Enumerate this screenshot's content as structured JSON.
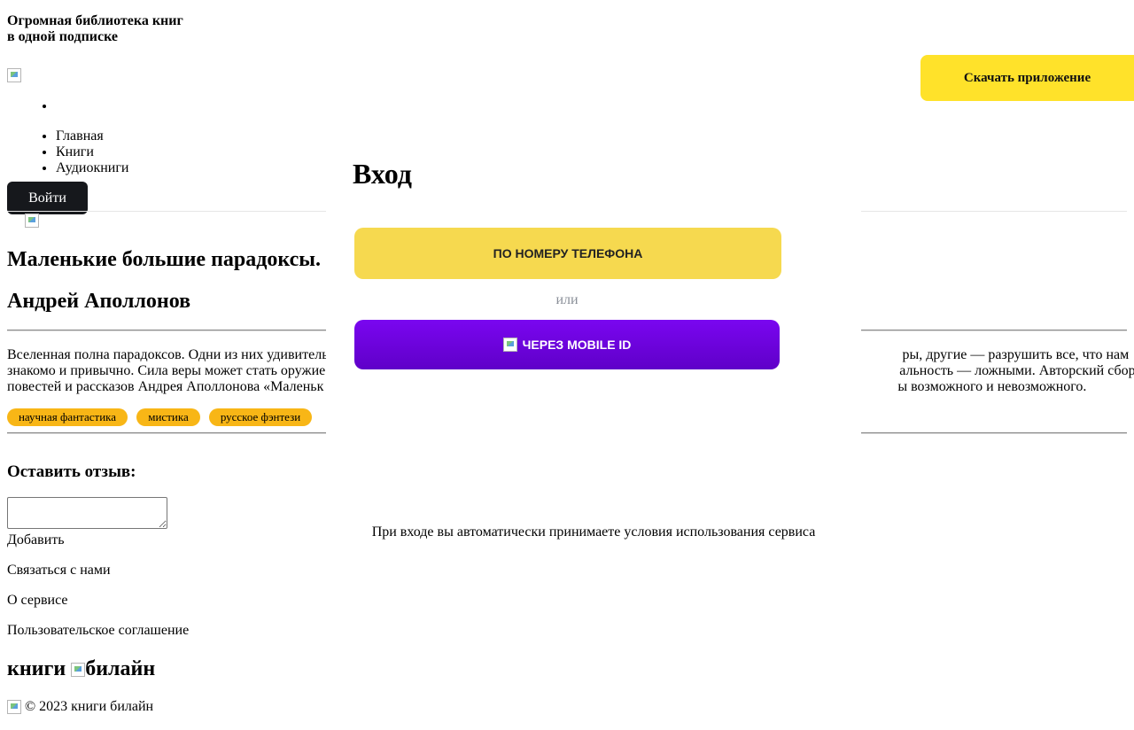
{
  "header": {
    "tagline_line1": "Огромная библиотека книг",
    "tagline_line2": "в одной подписке",
    "download_label": "Скачать приложение",
    "nav": [
      "Главная",
      "Книги",
      "Аудиокниги"
    ],
    "login_label": "Войти"
  },
  "book": {
    "title": "Маленькие большие парадоксы.",
    "author": "Андрей Аполлонов",
    "description_line1": "Вселенная полна парадоксов. Одни из них удивитель                                                                                                                                                                  ры, другие — разрушить все, что нам",
    "description_line2": "знакомо и привычно. Сила веры может стать оружие                                                                                                                                                                  альность — ложными. Авторский сборник",
    "description_line3": "повестей и рассказов Андрея Аполлонова «Маленьк                                                                                                                                                                  ы возможного и невозможного.",
    "tags": [
      "научная фантастика",
      "мистика",
      "русское фэнтези"
    ]
  },
  "review": {
    "title": "Оставить отзыв:",
    "add_label": "Добавить"
  },
  "footer": {
    "contact": "Связаться с нами",
    "about": "О сервисе",
    "agreement": "Пользовательское соглашение",
    "brand_text": "книги",
    "brand_alt": "билайн",
    "copyright": "© 2023 книги билайн"
  },
  "modal": {
    "title": "Вход",
    "phone_button": "ПО НОМЕРУ ТЕЛЕФОНА",
    "or": "или",
    "mobile_id_button": "ЧЕРЕЗ MOBILE ID",
    "terms": "При входе вы автоматически принимаете условия использования сервиса"
  },
  "colors": {
    "download_bg": "#ffe22a",
    "login_bg": "#16181c",
    "tag_bg": "#f8b616",
    "phone_bg": "#f6d94f",
    "mobile_bg": "#6a00dc"
  }
}
